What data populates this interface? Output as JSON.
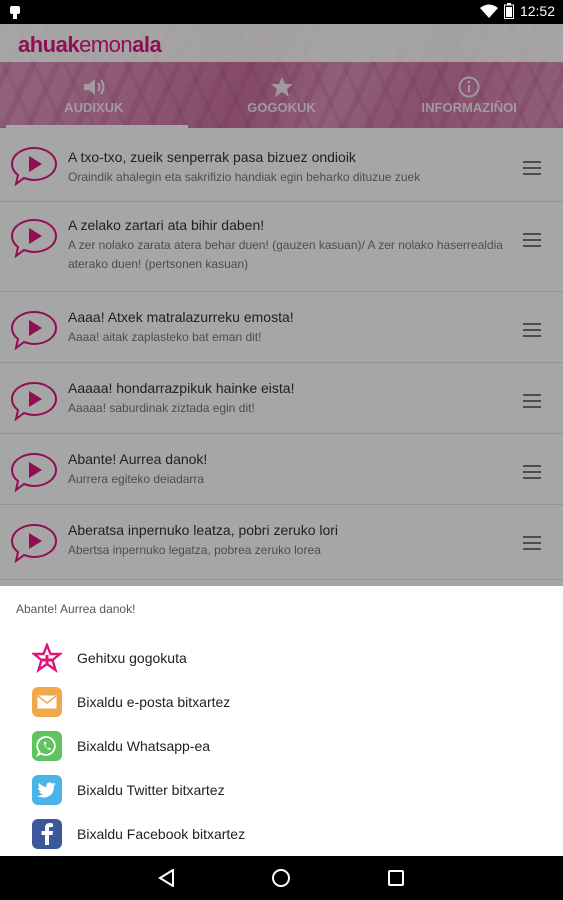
{
  "status_bar": {
    "time": "12:52"
  },
  "app": {
    "logo": {
      "part1": "ahuak",
      "part2": "emon",
      "part3": "ala"
    },
    "tabs": [
      {
        "label": "AUDIXUK",
        "icon": "speaker-icon",
        "active": true
      },
      {
        "label": "GOGOKUK",
        "icon": "star-icon",
        "active": false
      },
      {
        "label": "INFORMAZIÑOI",
        "icon": "info-icon",
        "active": false
      }
    ]
  },
  "list": {
    "items": [
      {
        "title": "A txo-txo, zueik senperrak pasa bizuez ondioik",
        "subtitle": "Oraindik ahalegin eta sakrifizio handiak egin beharko dituzue zuek"
      },
      {
        "title": "A zelako zartari ata bihir daben!",
        "subtitle": "A zer nolako zarata atera behar duen! (gauzen kasuan)/ A zer nolako haserrealdia aterako duen! (pertsonen kasuan)"
      },
      {
        "title": "Aaaa! Atxek matralazurreku emosta!",
        "subtitle": "Aaaa! aitak zaplasteko bat eman dit!"
      },
      {
        "title": "Aaaaa! hondarrazpikuk hainke eista!",
        "subtitle": "Aaaaa! saburdinak ziztada egin dit!"
      },
      {
        "title": "Abante! Aurrea danok!",
        "subtitle": "Aurrera egiteko deiadarra"
      },
      {
        "title": "Aberatsa inpernuko leatza, pobri zeruko lori",
        "subtitle": "Abertsa inpernuko legatza, pobrea zeruko lorea"
      }
    ]
  },
  "bottom_sheet": {
    "title": "Abante! Aurrea danok!",
    "actions": [
      {
        "label": "Gehitxu gogokuta",
        "icon": "add-favorite-star-icon",
        "color": "#e0147d"
      },
      {
        "label": "Bixaldu e-posta bitxartez",
        "icon": "email-icon",
        "color": "#f0a94a"
      },
      {
        "label": "Bixaldu Whatsapp-ea",
        "icon": "whatsapp-icon",
        "color": "#5fc45d"
      },
      {
        "label": "Bixaldu Twitter bitxartez",
        "icon": "twitter-icon",
        "color": "#4ab3e8"
      },
      {
        "label": "Bixaldu Facebook bitxartez",
        "icon": "facebook-icon",
        "color": "#3b5998"
      }
    ]
  },
  "colors": {
    "accent": "#e0147d",
    "tab_overlay": "#cd5a96"
  }
}
